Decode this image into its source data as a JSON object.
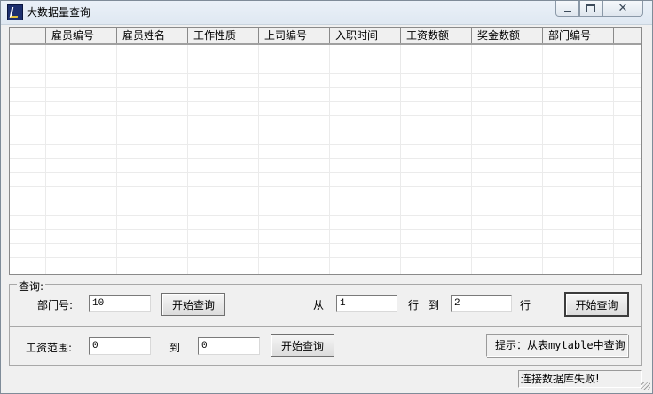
{
  "window": {
    "title": "大数据量查询",
    "close_glyph": "✕"
  },
  "grid": {
    "columns": [
      "雇员编号",
      "雇员姓名",
      "工作性质",
      "上司编号",
      "入职时间",
      "工资数额",
      "奖金数额",
      "部门编号"
    ],
    "rows": []
  },
  "query_group": {
    "label": "查询:",
    "department": {
      "label": "部门号:",
      "value": "10",
      "button": "开始查询"
    },
    "rows": {
      "from_label": "从",
      "from_value": "1",
      "row_label": "行",
      "to_label": "到",
      "to_value": "2",
      "row_label_end": "行",
      "button": "开始查询"
    },
    "salary": {
      "label": "工资范围:",
      "from_value": "0",
      "to_label": "到",
      "to_value": "0",
      "button": "开始查询"
    },
    "hint": "提示：从表mytable中查询"
  },
  "status": {
    "message": "连接数据库失败!"
  },
  "icons": {
    "app": "app-icon",
    "minimize": "minimize-icon",
    "maximize": "maximize-icon",
    "close": "close-icon",
    "grip": "resize-grip-icon"
  }
}
